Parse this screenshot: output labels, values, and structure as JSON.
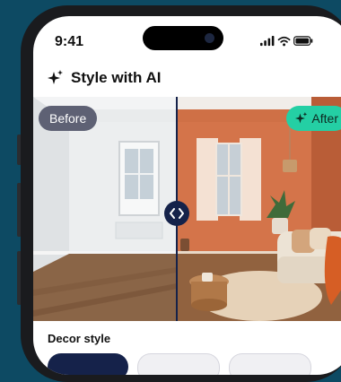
{
  "status_bar": {
    "time": "9:41"
  },
  "header": {
    "title": "Style with AI"
  },
  "compare": {
    "before_label": "Before",
    "after_label": "After"
  },
  "decor": {
    "label": "Decor style"
  }
}
